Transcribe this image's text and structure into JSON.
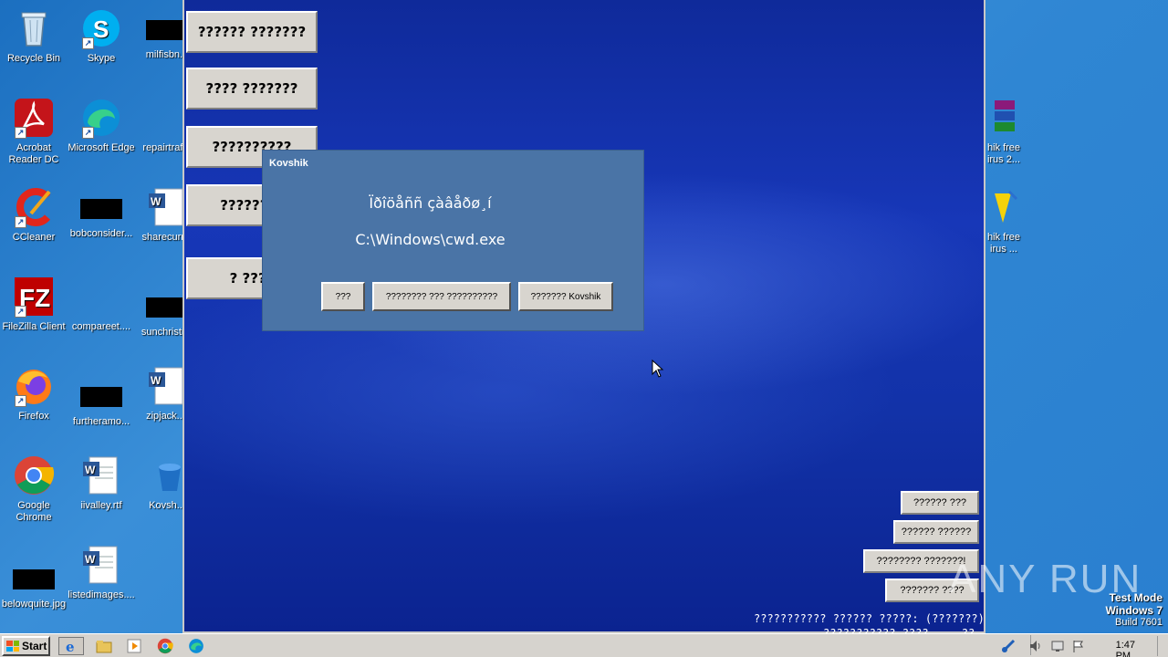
{
  "desktop": {
    "icons": [
      {
        "label": "Recycle Bin",
        "icon": "recycle-bin-icon"
      },
      {
        "label": "Skype",
        "icon": "skype-icon"
      },
      {
        "label": "milfisbn...",
        "icon": "black-file-icon"
      },
      {
        "label": "Acrobat Reader DC",
        "icon": "acrobat-icon"
      },
      {
        "label": "Microsoft Edge",
        "icon": "edge-icon"
      },
      {
        "label": "repairtraf...",
        "icon": "blank-file-icon"
      },
      {
        "label": "CCleaner",
        "icon": "ccleaner-icon"
      },
      {
        "label": "bobconsider...",
        "icon": "black-file-icon"
      },
      {
        "label": "sharecurr...",
        "icon": "word-doc-icon"
      },
      {
        "label": "FileZilla Client",
        "icon": "filezilla-icon"
      },
      {
        "label": "compareet....",
        "icon": "blank-file-icon"
      },
      {
        "label": "sunchristr...",
        "icon": "black-file-icon"
      },
      {
        "label": "Firefox",
        "icon": "firefox-icon"
      },
      {
        "label": "furtheramo...",
        "icon": "black-file-icon"
      },
      {
        "label": "zipjack....",
        "icon": "word-doc-icon"
      },
      {
        "label": "Google Chrome",
        "icon": "chrome-icon"
      },
      {
        "label": "iivalley.rtf",
        "icon": "word-doc-icon"
      },
      {
        "label": "Kovsh...",
        "icon": "kovshik-icon"
      },
      {
        "label": "belowquite.jpg",
        "icon": "black-file-icon"
      },
      {
        "label": "listedimages....",
        "icon": "word-doc-icon"
      }
    ],
    "right_icons": [
      {
        "label": "hik free\nirus 2...",
        "icon": "winrar-icon"
      },
      {
        "label": "hik free\nirus ...",
        "icon": "antivirus-icon"
      }
    ]
  },
  "app": {
    "side_buttons": [
      "?????? ???????",
      "???? ???????",
      "??????????",
      "????????",
      "? ????"
    ],
    "bottom_buttons": [
      "?????? ???",
      "?????? ??????",
      "???????? ???????!",
      "??????? ????"
    ],
    "status_line_1": "??????????? ?????? ?????: (???????)",
    "status_line_2": "??????????? ???? ... ?? ..."
  },
  "dialog": {
    "title": "Kovshik",
    "message_1": "Ïðîöåññ çàâåðø¸í",
    "message_2": "C:\\Windows\\cwd.exe",
    "buttons": [
      "???",
      "???????? ??? ??????????",
      "??????? Kovshik"
    ]
  },
  "watermark": {
    "text": "ANY RUN"
  },
  "test_mode": {
    "line1": "Test Mode",
    "line2": "Windows 7",
    "line3": "Build 7601"
  },
  "taskbar": {
    "start_label": "Start",
    "clock": "1:47 PM"
  },
  "colors": {
    "dialog_bg": "#4a74a6",
    "button_face": "#d8d5cf",
    "taskbar": "#d6d3ce"
  }
}
